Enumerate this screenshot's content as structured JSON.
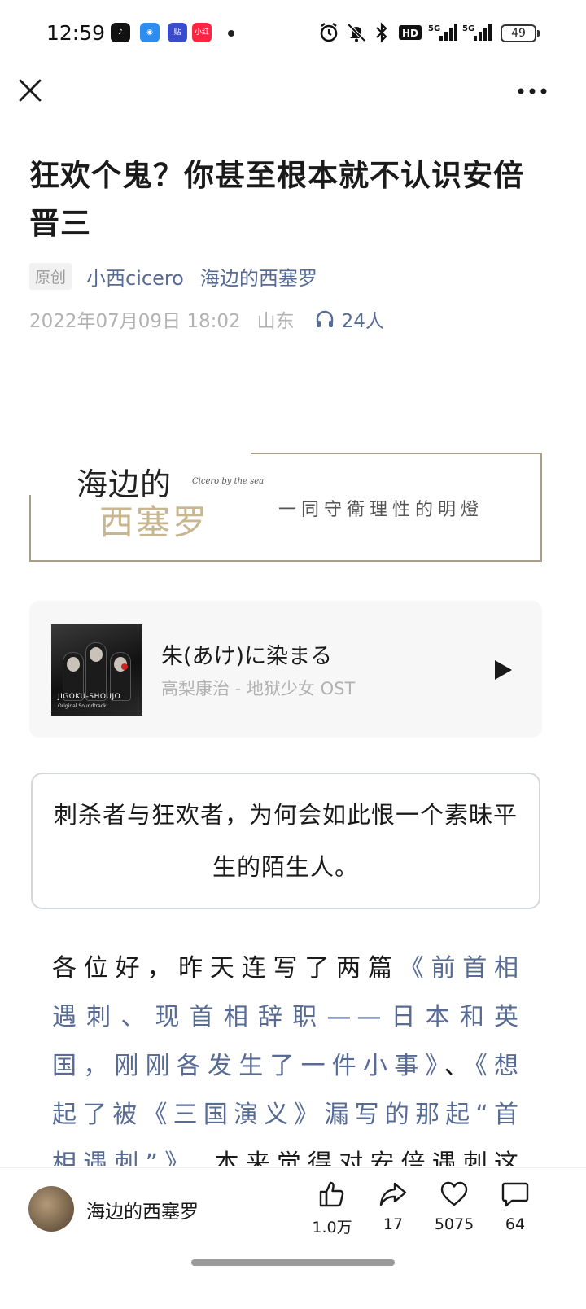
{
  "status_bar": {
    "time": "12:59",
    "battery": "49",
    "apps": [
      {
        "name": "tiktok-app-icon",
        "label": "♪",
        "color": "#111111"
      },
      {
        "name": "maps-app-icon",
        "label": "◉",
        "color": "#2d8cf0"
      },
      {
        "name": "tieba-app-icon",
        "label": "贴",
        "color": "#3b4cca"
      },
      {
        "name": "xiaohongshu-app-icon",
        "label": "小红书",
        "color": "#ff2442"
      }
    ],
    "network_label": "5G",
    "hd_label": "HD"
  },
  "article": {
    "title": "狂欢个鬼？你甚至根本就不认识安倍晋三",
    "original_tag": "原创",
    "author": "小西cicero",
    "account": "海边的西塞罗",
    "date": "2022年07月09日 18:02",
    "location": "山东",
    "listeners": "24人"
  },
  "banner": {
    "title_line1": "海边的",
    "title_en": "Cicero by the sea",
    "title_line2": "西塞罗",
    "slogan": "一同守衛理性的明燈"
  },
  "music": {
    "song": "朱(あけ)に染まる",
    "artist": "高梨康治 - 地狱少女 OST",
    "cover_logo": "JIGOKU-SHOUJO",
    "cover_sub": "Original Soundtrack"
  },
  "quote": "刺杀者与狂欢者，为何会如此恨一个素昧平生的陌生人。",
  "body": {
    "intro": "各位好，昨天连写了两篇",
    "link1": "《前首相遇刺、现首相辞职——日本和英国，刚刚各发生了一件小事》",
    "sep": "、",
    "link2": "《想起了被《三国演义》漏写的那起“首相遇刺”》",
    "rest": "，本来觉得对安倍遇刺这件事"
  },
  "bottom_bar": {
    "account_name": "海边的西塞罗",
    "like_count": "1.0万",
    "share_count": "17",
    "favorite_count": "5075",
    "comment_count": "64"
  }
}
